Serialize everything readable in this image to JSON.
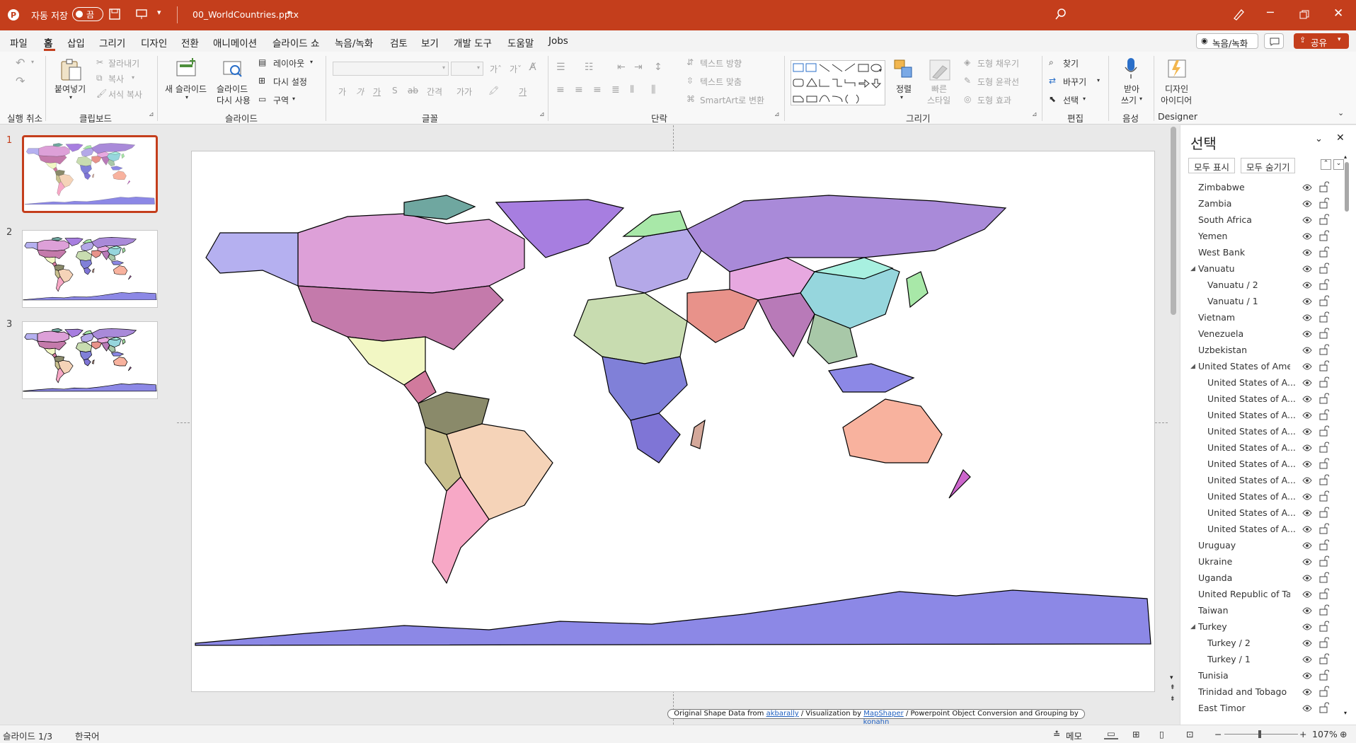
{
  "titlebar": {
    "autosave_label": "자동 저장",
    "autosave_state": "끔",
    "filename": "00_WorldCountries.pptx"
  },
  "menu": {
    "tabs": [
      "파일",
      "홈",
      "삽입",
      "그리기",
      "디자인",
      "전환",
      "애니메이션",
      "슬라이드 쇼",
      "녹음/녹화",
      "검토",
      "보기",
      "개발 도구",
      "도움말",
      "Jobs"
    ],
    "active": "홈",
    "record_label": "녹음/녹화",
    "share_label": "공유"
  },
  "ribbon": {
    "undo_group": "실행 취소",
    "clipboard": {
      "paste": "붙여넣기",
      "cut": "잘라내기",
      "copy": "복사",
      "format_painter": "서식 복사",
      "group": "클립보드"
    },
    "slides": {
      "new_slide": "새 슬라이드",
      "reuse_line1": "슬라이드",
      "reuse_line2": "다시 사용",
      "layout": "레이아웃",
      "reset": "다시 설정",
      "section": "구역",
      "group": "슬라이드"
    },
    "font": {
      "group": "글꼴"
    },
    "paragraph": {
      "text_direction": "텍스트 방향",
      "align_text": "텍스트 맞춤",
      "smartart": "SmartArt로 변환",
      "group": "단락"
    },
    "drawing": {
      "arrange": "정렬",
      "quick_style_1": "빠른",
      "quick_style_2": "스타일",
      "fill": "도형 채우기",
      "outline": "도형 윤곽선",
      "effects": "도형 효과",
      "group": "그리기"
    },
    "editing": {
      "find": "찾기",
      "replace": "바꾸기",
      "select": "선택",
      "group": "편집"
    },
    "voice": {
      "dictate_1": "받아",
      "dictate_2": "쓰기",
      "group": "음성"
    },
    "designer": {
      "label_1": "디자인",
      "label_2": "아이디어",
      "group": "Designer"
    }
  },
  "thumbnails": [
    {
      "num": "1"
    },
    {
      "num": "2"
    },
    {
      "num": "3"
    }
  ],
  "slide": {
    "credit_prefix": "Original Shape Data from",
    "credit_link1": "akbarally",
    "credit_mid1": "/ Visualization  by",
    "credit_link2": "MapShaper",
    "credit_mid2": "/ Powerpoint Object Conversion and Grouping  by",
    "credit_link3": "konahn"
  },
  "selection_pane": {
    "title": "선택",
    "show_all": "모두 표시",
    "hide_all": "모두 숨기기",
    "items": [
      {
        "label": "Zimbabwe",
        "level": 0
      },
      {
        "label": "Zambia",
        "level": 0
      },
      {
        "label": "South Africa",
        "level": 0
      },
      {
        "label": "Yemen",
        "level": 0
      },
      {
        "label": "West Bank",
        "level": 0
      },
      {
        "label": "Vanuatu",
        "level": 0,
        "group": true
      },
      {
        "label": "Vanuatu / 2",
        "level": 1
      },
      {
        "label": "Vanuatu / 1",
        "level": 1
      },
      {
        "label": "Vietnam",
        "level": 0
      },
      {
        "label": "Venezuela",
        "level": 0
      },
      {
        "label": "Uzbekistan",
        "level": 0
      },
      {
        "label": "United States of Ame...",
        "level": 0,
        "group": true
      },
      {
        "label": "United States of A...",
        "level": 1
      },
      {
        "label": "United States of A...",
        "level": 1
      },
      {
        "label": "United States of A...",
        "level": 1
      },
      {
        "label": "United States of A...",
        "level": 1
      },
      {
        "label": "United States of A...",
        "level": 1
      },
      {
        "label": "United States of A...",
        "level": 1
      },
      {
        "label": "United States of A...",
        "level": 1
      },
      {
        "label": "United States of A...",
        "level": 1
      },
      {
        "label": "United States of A...",
        "level": 1
      },
      {
        "label": "United States of A...",
        "level": 1
      },
      {
        "label": "Uruguay",
        "level": 0
      },
      {
        "label": "Ukraine",
        "level": 0
      },
      {
        "label": "Uganda",
        "level": 0
      },
      {
        "label": "United Republic of Ta...",
        "level": 0
      },
      {
        "label": "Taiwan",
        "level": 0
      },
      {
        "label": "Turkey",
        "level": 0,
        "group": true
      },
      {
        "label": "Turkey / 2",
        "level": 1
      },
      {
        "label": "Turkey / 1",
        "level": 1
      },
      {
        "label": "Tunisia",
        "level": 0
      },
      {
        "label": "Trinidad and Tobago",
        "level": 0
      },
      {
        "label": "East Timor",
        "level": 0
      }
    ]
  },
  "status": {
    "slide_info": "슬라이드 1/3",
    "language": "한국어",
    "notes": "메모",
    "zoom": "107%"
  },
  "colors": {
    "accent": "#c43e1c",
    "antarctica": "#8c88e6"
  }
}
